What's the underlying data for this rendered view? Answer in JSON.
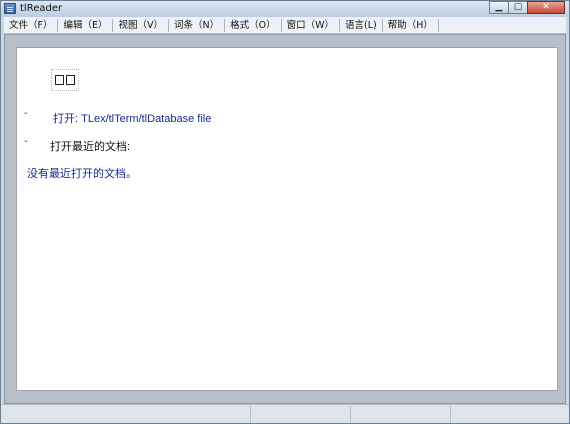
{
  "window": {
    "title": "tlReader",
    "buttons": {
      "minimize": "▁",
      "maximize": "▢",
      "close": "✕"
    }
  },
  "menubar": {
    "items": [
      "文件（F）",
      "编辑（E）",
      "视图（V）",
      "词条（N）",
      "格式（O）",
      "窗口（W）",
      "语言(L)",
      "帮助（H）"
    ]
  },
  "content": {
    "logo_glyphs": "□□",
    "open_link": "打开: TLex/tlTerm/tlDatabase file",
    "recent_label": "打开最近的文档:",
    "no_recent": "没有最近打开的文档。",
    "bullet": "-"
  },
  "colors": {
    "link": "#1b2a90",
    "page_bg": "#ffffff",
    "client_bg": "#b7c0ca"
  }
}
